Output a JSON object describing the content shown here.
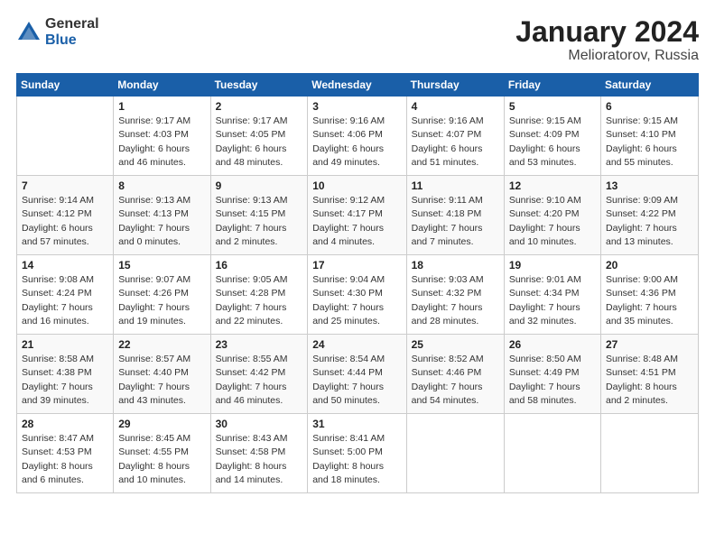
{
  "logo": {
    "general": "General",
    "blue": "Blue"
  },
  "title": "January 2024",
  "subtitle": "Melioratorov, Russia",
  "days_header": [
    "Sunday",
    "Monday",
    "Tuesday",
    "Wednesday",
    "Thursday",
    "Friday",
    "Saturday"
  ],
  "weeks": [
    [
      {
        "day": "",
        "info": ""
      },
      {
        "day": "1",
        "info": "Sunrise: 9:17 AM\nSunset: 4:03 PM\nDaylight: 6 hours\nand 46 minutes."
      },
      {
        "day": "2",
        "info": "Sunrise: 9:17 AM\nSunset: 4:05 PM\nDaylight: 6 hours\nand 48 minutes."
      },
      {
        "day": "3",
        "info": "Sunrise: 9:16 AM\nSunset: 4:06 PM\nDaylight: 6 hours\nand 49 minutes."
      },
      {
        "day": "4",
        "info": "Sunrise: 9:16 AM\nSunset: 4:07 PM\nDaylight: 6 hours\nand 51 minutes."
      },
      {
        "day": "5",
        "info": "Sunrise: 9:15 AM\nSunset: 4:09 PM\nDaylight: 6 hours\nand 53 minutes."
      },
      {
        "day": "6",
        "info": "Sunrise: 9:15 AM\nSunset: 4:10 PM\nDaylight: 6 hours\nand 55 minutes."
      }
    ],
    [
      {
        "day": "7",
        "info": "Sunrise: 9:14 AM\nSunset: 4:12 PM\nDaylight: 6 hours\nand 57 minutes."
      },
      {
        "day": "8",
        "info": "Sunrise: 9:13 AM\nSunset: 4:13 PM\nDaylight: 7 hours\nand 0 minutes."
      },
      {
        "day": "9",
        "info": "Sunrise: 9:13 AM\nSunset: 4:15 PM\nDaylight: 7 hours\nand 2 minutes."
      },
      {
        "day": "10",
        "info": "Sunrise: 9:12 AM\nSunset: 4:17 PM\nDaylight: 7 hours\nand 4 minutes."
      },
      {
        "day": "11",
        "info": "Sunrise: 9:11 AM\nSunset: 4:18 PM\nDaylight: 7 hours\nand 7 minutes."
      },
      {
        "day": "12",
        "info": "Sunrise: 9:10 AM\nSunset: 4:20 PM\nDaylight: 7 hours\nand 10 minutes."
      },
      {
        "day": "13",
        "info": "Sunrise: 9:09 AM\nSunset: 4:22 PM\nDaylight: 7 hours\nand 13 minutes."
      }
    ],
    [
      {
        "day": "14",
        "info": "Sunrise: 9:08 AM\nSunset: 4:24 PM\nDaylight: 7 hours\nand 16 minutes."
      },
      {
        "day": "15",
        "info": "Sunrise: 9:07 AM\nSunset: 4:26 PM\nDaylight: 7 hours\nand 19 minutes."
      },
      {
        "day": "16",
        "info": "Sunrise: 9:05 AM\nSunset: 4:28 PM\nDaylight: 7 hours\nand 22 minutes."
      },
      {
        "day": "17",
        "info": "Sunrise: 9:04 AM\nSunset: 4:30 PM\nDaylight: 7 hours\nand 25 minutes."
      },
      {
        "day": "18",
        "info": "Sunrise: 9:03 AM\nSunset: 4:32 PM\nDaylight: 7 hours\nand 28 minutes."
      },
      {
        "day": "19",
        "info": "Sunrise: 9:01 AM\nSunset: 4:34 PM\nDaylight: 7 hours\nand 32 minutes."
      },
      {
        "day": "20",
        "info": "Sunrise: 9:00 AM\nSunset: 4:36 PM\nDaylight: 7 hours\nand 35 minutes."
      }
    ],
    [
      {
        "day": "21",
        "info": "Sunrise: 8:58 AM\nSunset: 4:38 PM\nDaylight: 7 hours\nand 39 minutes."
      },
      {
        "day": "22",
        "info": "Sunrise: 8:57 AM\nSunset: 4:40 PM\nDaylight: 7 hours\nand 43 minutes."
      },
      {
        "day": "23",
        "info": "Sunrise: 8:55 AM\nSunset: 4:42 PM\nDaylight: 7 hours\nand 46 minutes."
      },
      {
        "day": "24",
        "info": "Sunrise: 8:54 AM\nSunset: 4:44 PM\nDaylight: 7 hours\nand 50 minutes."
      },
      {
        "day": "25",
        "info": "Sunrise: 8:52 AM\nSunset: 4:46 PM\nDaylight: 7 hours\nand 54 minutes."
      },
      {
        "day": "26",
        "info": "Sunrise: 8:50 AM\nSunset: 4:49 PM\nDaylight: 7 hours\nand 58 minutes."
      },
      {
        "day": "27",
        "info": "Sunrise: 8:48 AM\nSunset: 4:51 PM\nDaylight: 8 hours\nand 2 minutes."
      }
    ],
    [
      {
        "day": "28",
        "info": "Sunrise: 8:47 AM\nSunset: 4:53 PM\nDaylight: 8 hours\nand 6 minutes."
      },
      {
        "day": "29",
        "info": "Sunrise: 8:45 AM\nSunset: 4:55 PM\nDaylight: 8 hours\nand 10 minutes."
      },
      {
        "day": "30",
        "info": "Sunrise: 8:43 AM\nSunset: 4:58 PM\nDaylight: 8 hours\nand 14 minutes."
      },
      {
        "day": "31",
        "info": "Sunrise: 8:41 AM\nSunset: 5:00 PM\nDaylight: 8 hours\nand 18 minutes."
      },
      {
        "day": "",
        "info": ""
      },
      {
        "day": "",
        "info": ""
      },
      {
        "day": "",
        "info": ""
      }
    ]
  ]
}
